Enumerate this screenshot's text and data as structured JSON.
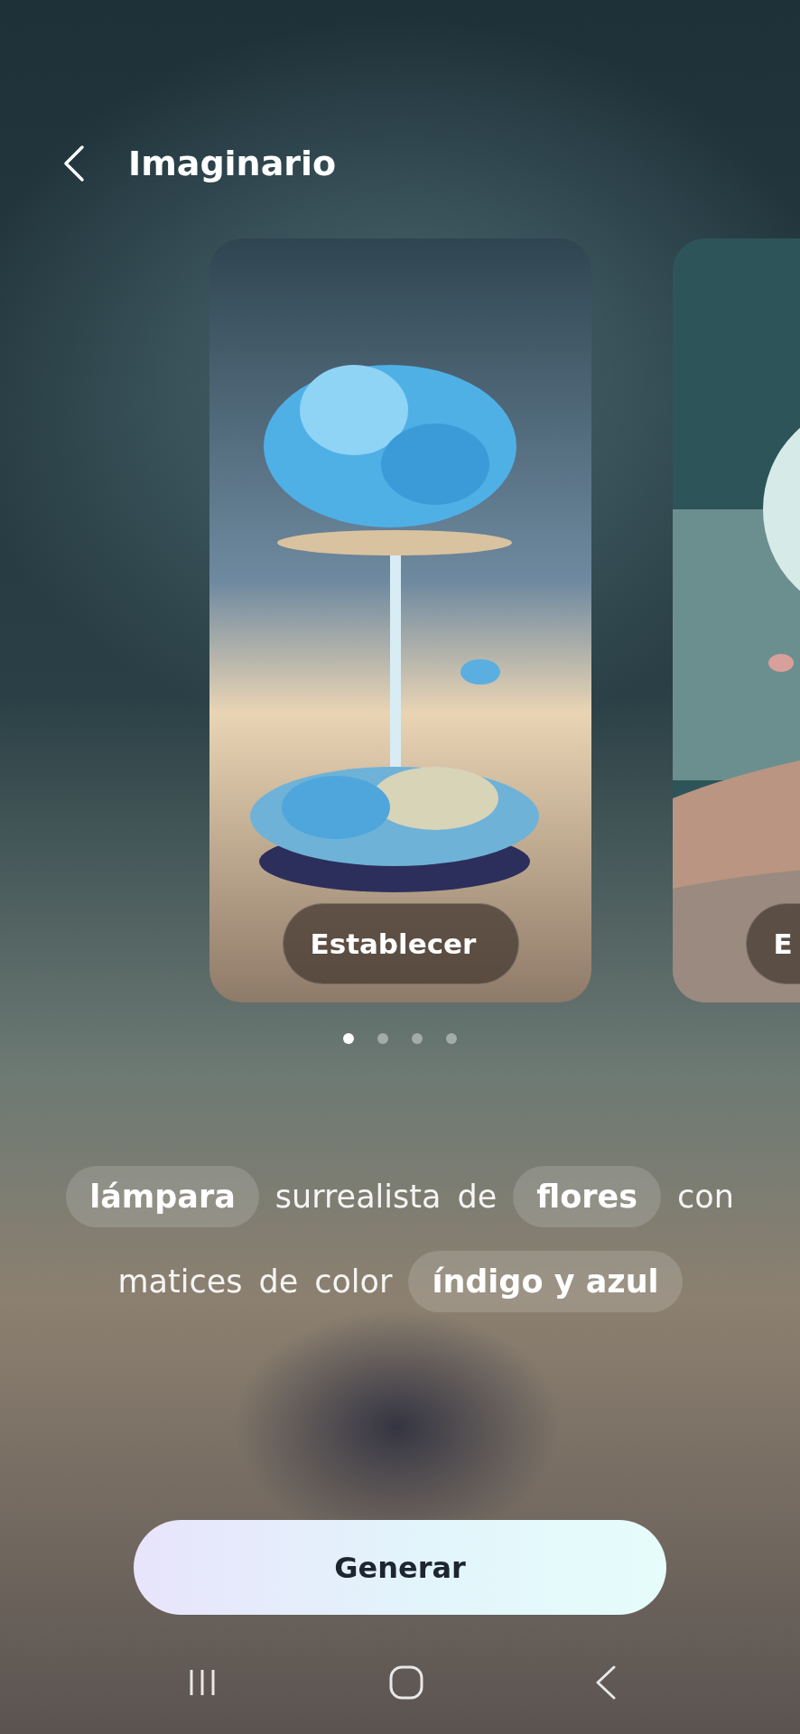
{
  "header": {
    "title": "Imaginario"
  },
  "cards": [
    {
      "kind": "flower-lamp",
      "button": "Establecer"
    },
    {
      "kind": "moon-desert",
      "button": "E"
    }
  ],
  "pager": {
    "dots": [
      {
        "selected": true
      },
      {
        "selected": false
      },
      {
        "selected": false
      },
      {
        "selected": false
      }
    ]
  },
  "prompt": {
    "lines": [
      [
        {
          "text": "lámpara",
          "highlighted": true
        },
        {
          "text": "surrealista",
          "highlighted": false
        },
        {
          "text": "de",
          "highlighted": false
        },
        {
          "text": "flores",
          "highlighted": true
        },
        {
          "text": "con",
          "highlighted": false
        }
      ],
      [
        {
          "text": "matices",
          "highlighted": false
        },
        {
          "text": "de",
          "highlighted": false
        },
        {
          "text": "color",
          "highlighted": false
        },
        {
          "text": "índigo y azul",
          "highlighted": true
        }
      ]
    ]
  },
  "generate_button": "Generar"
}
